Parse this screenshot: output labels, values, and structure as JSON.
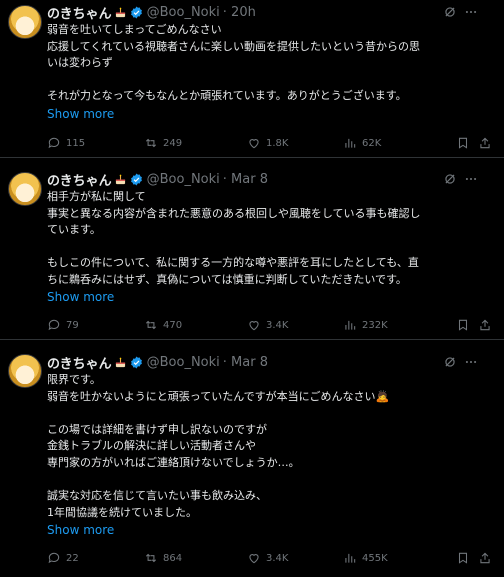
{
  "tweets": [
    {
      "name": "のきちゃん",
      "handle": "@Boo_Noki",
      "time": "· 20h",
      "lines": [
        "弱音を吐いてしまってごめんなさい",
        "応援してくれている視聴者さんに楽しい動画を提供したいという昔からの思",
        "いは変わらず",
        "",
        "それが力となって今もなんとか頑張れています。ありがとうございます。"
      ],
      "show_more": "Show more",
      "replies": "115",
      "reposts": "249",
      "likes": "1.8K",
      "views": "62K"
    },
    {
      "name": "のきちゃん",
      "handle": "@Boo_Noki",
      "time": "· Mar 8",
      "lines": [
        "相手方が私に関して",
        "事実と異なる内容が含まれた悪意のある根回しや風聴をしている事も確認し",
        "ています。",
        "",
        "もしこの件について、私に関する一方的な噂や悪評を耳にしたとしても、直",
        "ちに鵜呑みにはせず、真偽については慎重に判断していただきたいです。"
      ],
      "show_more": "Show more",
      "replies": "79",
      "reposts": "470",
      "likes": "3.4K",
      "views": "232K"
    },
    {
      "name": "のきちゃん",
      "handle": "@Boo_Noki",
      "time": "· Mar 8",
      "lines": [
        "限界です。",
        "弱音を吐かないようにと頑張っていたんですが本当にごめんなさい🙇",
        "",
        "この場では詳細を書けず申し訳ないのですが",
        "金銭トラブルの解決に詳しい活動者さんや",
        "専門家の方がいればご連絡頂けないでしょうか…。",
        "",
        "誠実な対応を信じて言いたい事も飲み込み、",
        "1年間協議を続けていました。"
      ],
      "show_more": "Show more",
      "replies": "22",
      "reposts": "864",
      "likes": "3.4K",
      "views": "455K"
    }
  ]
}
